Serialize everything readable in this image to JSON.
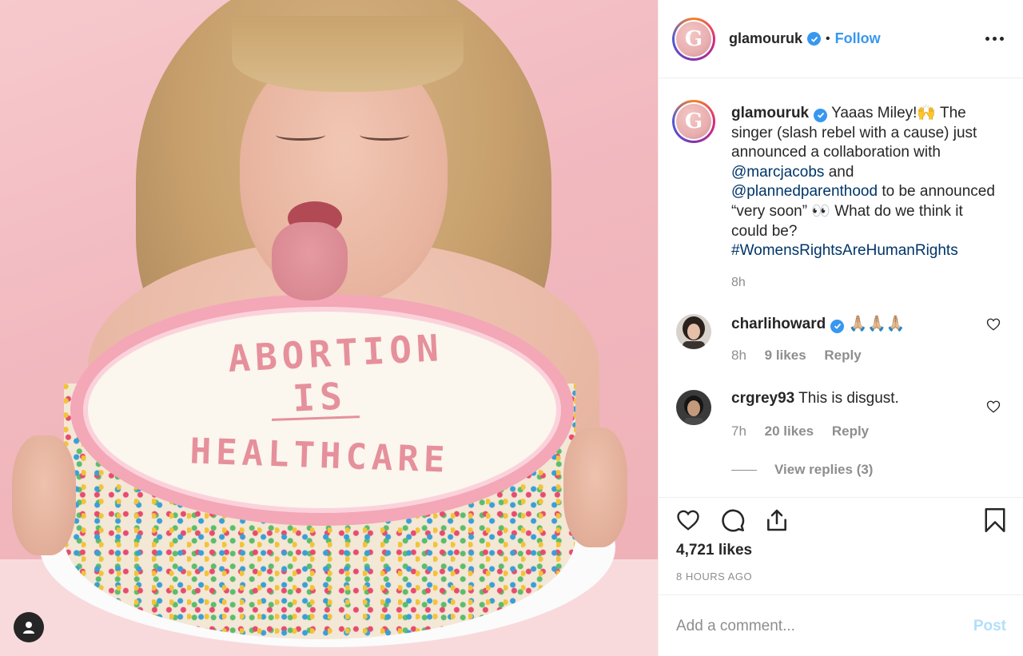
{
  "colors": {
    "accent": "#3897f0",
    "text": "#262626",
    "secondary": "#8e8e8e",
    "link": "#003569",
    "post_disabled": "#b2dffc"
  },
  "media": {
    "cake_text": [
      "ABORTION",
      "IS",
      "HEALTHCARE"
    ],
    "user_tag_icon": "user-tag-icon"
  },
  "header": {
    "avatar_letter": "G",
    "username": "glamouruk",
    "separator": "•",
    "follow_label": "Follow",
    "more_icon": "more-options-icon"
  },
  "caption": {
    "avatar_letter": "G",
    "username": "glamouruk",
    "text_1": "Yaaas Miley!🙌  The singer (slash rebel with a cause) just announced a collaboration with ",
    "mention_1": "@marcjacobs",
    "text_2": " and ",
    "mention_2": "@plannedparenthood",
    "text_3": " to be announced “very soon” 👀  What do we think it could be? ",
    "hashtag": "#WomensRightsAreHumanRights",
    "time": "8h"
  },
  "comments": [
    {
      "username": "charlihoward",
      "text": "🙏🏼🙏🏼🙏🏼",
      "time": "8h",
      "likes": "9 likes",
      "reply_label": "Reply"
    },
    {
      "username": "crgrey93",
      "text": "This is disgust.",
      "time": "7h",
      "likes": "20 likes",
      "reply_label": "Reply"
    }
  ],
  "view_replies": "View replies (3)",
  "actions": {
    "like_icon": "heart-icon",
    "comment_icon": "comment-icon",
    "share_icon": "share-icon",
    "save_icon": "bookmark-icon"
  },
  "likes": "4,721 likes",
  "posted_ago": "8 HOURS AGO",
  "comment_box": {
    "placeholder": "Add a comment...",
    "post_label": "Post"
  }
}
